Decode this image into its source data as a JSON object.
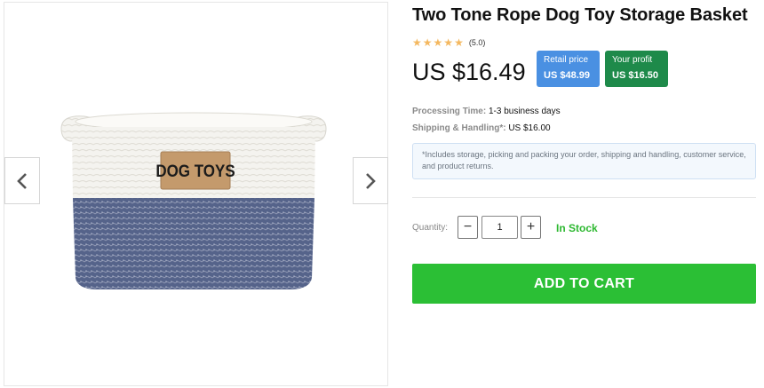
{
  "product": {
    "title": "Two Tone Rope Dog Toy Storage Basket",
    "rating": "(5.0)",
    "rating_stars": 5,
    "price": "US $16.49",
    "retail_label": "Retail price",
    "retail_value": "US $48.99",
    "profit_label": "Your profit",
    "profit_value": "US $16.50",
    "tag_text": "DOG TOYS"
  },
  "details": {
    "processing_label": "Processing Time:",
    "processing_value": "1-3 business days",
    "shipping_label": "Shipping & Handling*:",
    "shipping_value": "US $16.00",
    "note": "*Includes storage, picking and packing your order, shipping and handling, customer service, and product returns."
  },
  "quantity": {
    "label": "Quantity:",
    "value": "1",
    "minus": "−",
    "plus": "+"
  },
  "stock": "In Stock",
  "cart_button": "ADD TO CART",
  "colors": {
    "star": "#f4b860",
    "retail_badge": "#4a90e2",
    "profit_badge": "#1e8a4a",
    "in_stock": "#2db830",
    "cart_button": "#2bbf35"
  },
  "icons": {
    "prev": "chevron-left-icon",
    "next": "chevron-right-icon"
  }
}
